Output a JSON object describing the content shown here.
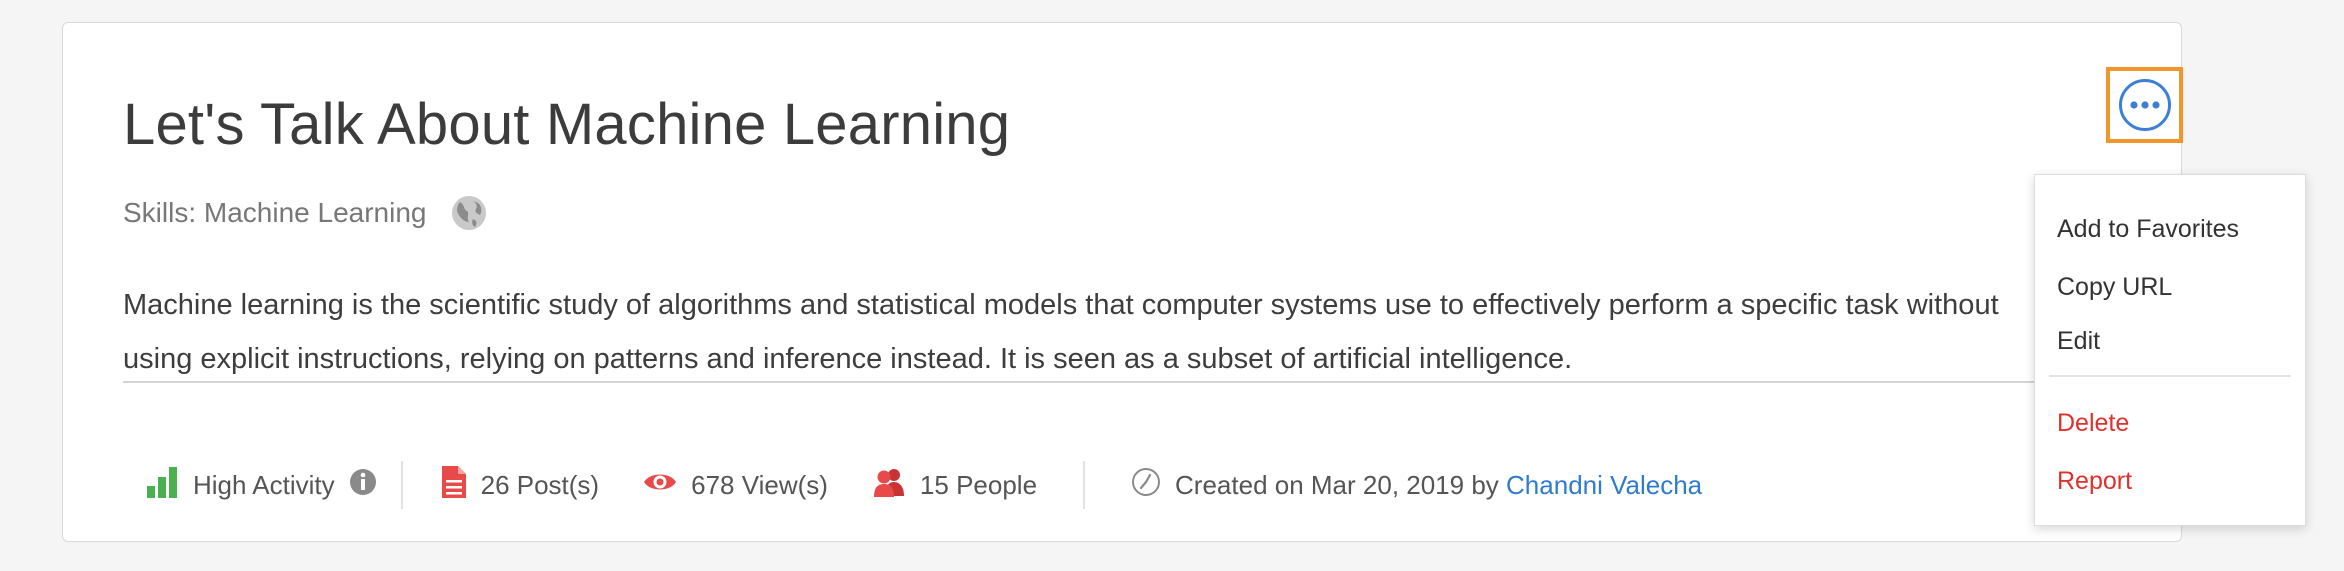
{
  "card": {
    "title": "Let's Talk About Machine Learning",
    "skills_label": "Skills: Machine Learning",
    "description_line1": "Machine learning is the scientific study of algorithms and statistical models that computer systems use to effectively perform a specific task without",
    "description_line2": "using explicit instructions, relying on patterns and inference instead. It is seen as a subset of artificial intelligence."
  },
  "stats": {
    "activity": "High Activity",
    "posts": "26 Post(s)",
    "views": "678 View(s)",
    "people": "15 People",
    "created_prefix": "Created on Mar 20, 2019 by",
    "author": "Chandni Valecha"
  },
  "menu": {
    "items": [
      "Add to Favorites",
      "Copy URL",
      "Edit",
      "Delete",
      "Report"
    ]
  },
  "colors": {
    "accent_blue": "#3d7fd8",
    "highlight_orange": "#f0962a",
    "danger_red": "#e0312d",
    "activity_green": "#4bb04f",
    "icon_red": "#e84a4a"
  },
  "icons": [
    "globe-icon",
    "bar-chart-icon",
    "info-icon",
    "document-icon",
    "eye-icon",
    "people-icon",
    "clock-icon",
    "more-dots-icon"
  ]
}
